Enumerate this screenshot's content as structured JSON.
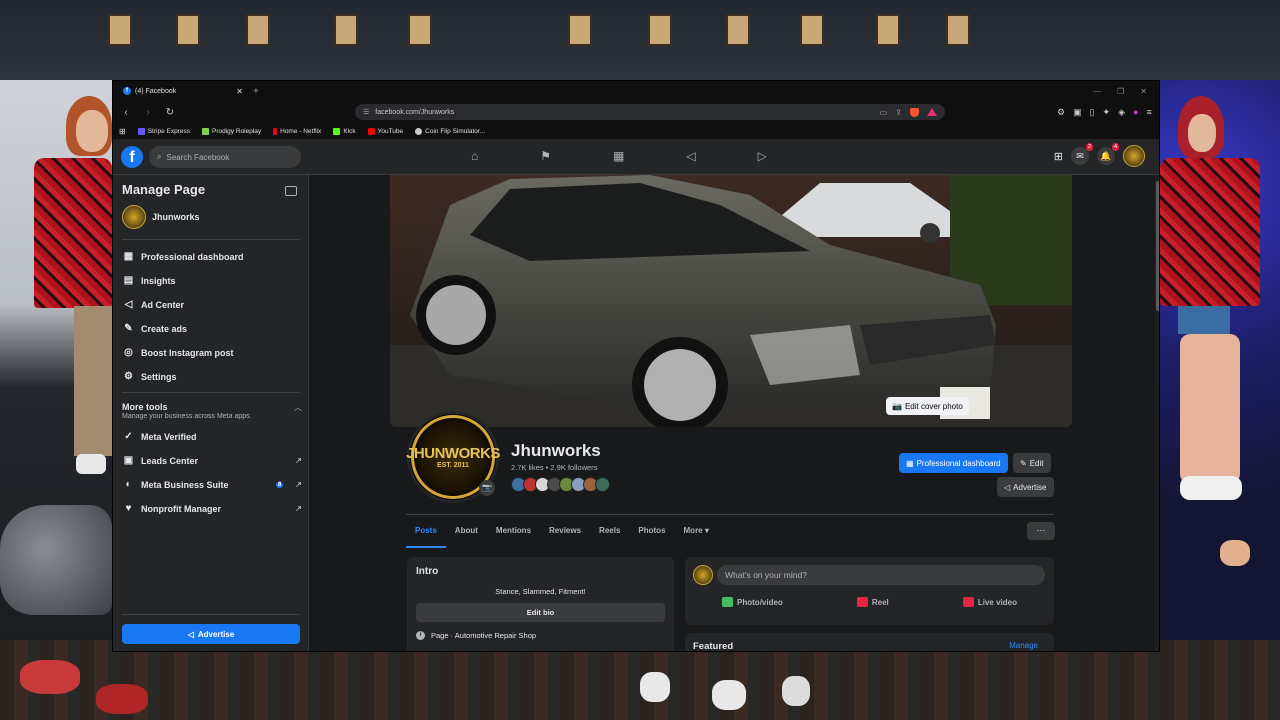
{
  "browser": {
    "tab_title": "(4) Facebook",
    "url": "facebook.com/Jhunworks",
    "bookmarks": [
      {
        "label": "Stripe Express",
        "color": "#635bff"
      },
      {
        "label": "Prodigy Roleplay",
        "color": "#7fd34a"
      },
      {
        "label": "Home - Netflix",
        "color": "#e50914"
      },
      {
        "label": "Kick",
        "color": "#53fc18"
      },
      {
        "label": "YouTube",
        "color": "#ff0000"
      },
      {
        "label": "Coin Flip Simulator...",
        "color": "#cccccc"
      }
    ]
  },
  "header": {
    "logo": "f",
    "search_placeholder": "Search Facebook",
    "messenger_badge": "2",
    "notifications_badge": "4"
  },
  "sidebar": {
    "title": "Manage Page",
    "page_name": "Jhunworks",
    "items": [
      {
        "label": "Professional dashboard",
        "icon": "dashboard-icon",
        "glyph": "▦"
      },
      {
        "label": "Insights",
        "icon": "insights-icon",
        "glyph": "▤"
      },
      {
        "label": "Ad Center",
        "icon": "megaphone-icon",
        "glyph": "📣"
      },
      {
        "label": "Create ads",
        "icon": "pencil-icon",
        "glyph": "✎"
      },
      {
        "label": "Boost Instagram post",
        "icon": "instagram-icon",
        "glyph": "◎"
      },
      {
        "label": "Settings",
        "icon": "gear-icon",
        "glyph": "⚙"
      }
    ],
    "more_tools": {
      "title": "More tools",
      "subtitle": "Manage your business across Meta apps."
    },
    "tools": [
      {
        "label": "Meta Verified",
        "icon": "verified-icon",
        "glyph": "✓",
        "external": false,
        "count": ""
      },
      {
        "label": "Leads Center",
        "icon": "leads-icon",
        "glyph": "▣",
        "external": true,
        "count": ""
      },
      {
        "label": "Meta Business Suite",
        "icon": "business-suite-icon",
        "glyph": "◐",
        "external": true,
        "count": "8"
      },
      {
        "label": "Nonprofit Manager",
        "icon": "nonprofit-icon",
        "glyph": "♥",
        "external": true,
        "count": ""
      }
    ],
    "advertise_label": "Advertise"
  },
  "profile": {
    "name": "Jhunworks",
    "stats": "2.7K likes • 2.9K followers",
    "logo_top": "JHUNWORKS",
    "logo_bottom": "EST. 2011",
    "edit_cover_label": "Edit cover photo",
    "professional_dashboard_label": "Professional dashboard",
    "edit_label": "Edit",
    "advertise_label": "Advertise"
  },
  "tabs": [
    "Posts",
    "About",
    "Mentions",
    "Reviews",
    "Reels",
    "Photos",
    "More ▾"
  ],
  "intro": {
    "title": "Intro",
    "bio": "Stance, Slammed, Fitment!",
    "edit_bio_label": "Edit bio",
    "category": "Page · Automotive Repair Shop"
  },
  "composer": {
    "placeholder": "What's on your mind?",
    "actions": [
      {
        "label": "Photo/video",
        "color": "#45bd62"
      },
      {
        "label": "Reel",
        "color": "#e42645"
      },
      {
        "label": "Live video",
        "color": "#e42645"
      }
    ]
  },
  "featured": {
    "title": "Featured",
    "manage_label": "Manage"
  }
}
